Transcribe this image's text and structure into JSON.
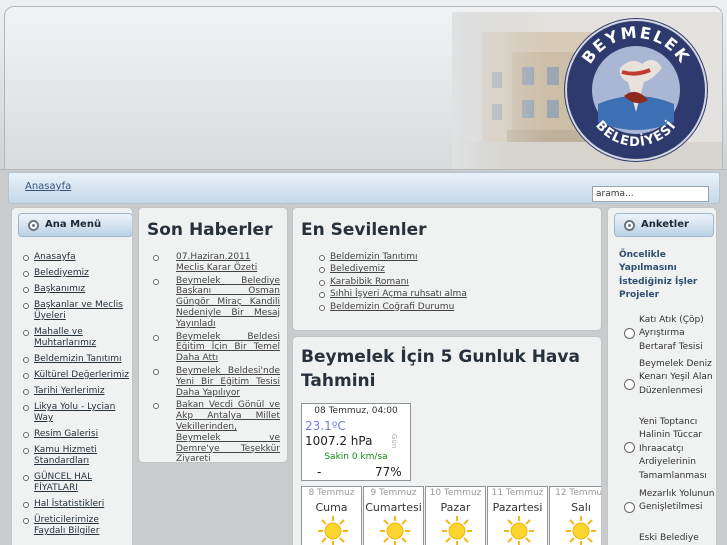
{
  "header": {
    "logo_text_top": "BEYMELEK",
    "logo_text_bottom": "BELEDİYESİ"
  },
  "nav": {
    "home_label": "Anasayfa",
    "search_value": "arama..."
  },
  "left_menu": {
    "title": "Ana Menü",
    "items": [
      "Anasayfa",
      "Belediyemiz",
      "Başkanımız",
      "Başkanlar ve Meclis Üyeleri",
      "Mahalle ve Muhtarlarımız",
      "Beldemizin Tanıtımı",
      "Kültürel Değerlerimiz",
      "Tarihi Yerlerimiz",
      "Likya Yolu - Lycian Way",
      "Resim Galerisi",
      "Kamu Hizmeti Standardları",
      "GÜNCEL HAL FİYATLARI",
      "Hal İstatistikleri",
      "Üreticilerimize Faydalı Bilgiler"
    ]
  },
  "news": {
    "title": "Son Haberler",
    "items": [
      "07.Haziran.2011 Meclis Karar Özeti",
      "Beymelek Belediye Başkanı Osman Güngör Miraç Kandili Nedeniyle Bir Mesaj Yayınladı",
      "Beymelek Beldesi Eğitim İçin Bir Temel Daha Attı",
      "Beymelek Beldesi'nde Yeni Bir Eğitim Tesisi Daha Yapılıyor",
      "Bakan Vecdi Gönül ve Akp Antalya Millet Vekillerinden, Beymelek ve Demre'ye Teşekkür Ziyareti"
    ]
  },
  "favorites": {
    "title": "En Sevilenler",
    "items": [
      "Beldemizin Tanıtımı",
      "Belediyemiz",
      "Karabibik Romanı",
      "Sıhhi İşyeri Açma ruhsatı alma",
      "Beldemizin Coğrafi Durumu"
    ]
  },
  "weather": {
    "title": "Beymelek İçin 5 Gunluk Hava Tahmini",
    "current": {
      "datetime": "08 Temmuz, 04:00",
      "temperature": "23.1ºC",
      "pressure": "1007.2 hPa",
      "wind": "Sakin 0 km/sa",
      "wind_dir": "-",
      "humidity": "77%",
      "side_label": "Gün"
    },
    "days": [
      {
        "date": "8 Temmuz",
        "name": "Cuma",
        "icon": "sun-icon"
      },
      {
        "date": "9 Temmuz",
        "name": "Cumartesi",
        "icon": "sun-icon"
      },
      {
        "date": "10 Temmuz",
        "name": "Pazar",
        "icon": "sun-icon"
      },
      {
        "date": "11 Temmuz",
        "name": "Pazartesi",
        "icon": "sun-icon"
      },
      {
        "date": "12 Temmuz",
        "name": "Salı",
        "icon": "sun-icon"
      }
    ]
  },
  "poll": {
    "title": "Anketler",
    "question": "Öncelikle Yapılmasını İstediğiniz İşler Projeler",
    "options": [
      "Katı Atık (Çöp) Ayrıştırma Bertaraf Tesisi",
      "Beymelek Deniz Kenarı Yeşil Alan Düzenlenmesi",
      "Yeni Toptancı Halinin Tüccar Ihraacatçı Ardiyelerinin Tamamlanması",
      "Mezarlık Yolunun Genişletilmesi",
      "Eski Belediye"
    ]
  },
  "colors": {
    "page_bg": "#c9cbcc",
    "nav_bar": "#c6d8e8",
    "poll_question": "#2c4e70",
    "wind_text": "#148a14",
    "temperature_text": "#6f7ed8"
  }
}
